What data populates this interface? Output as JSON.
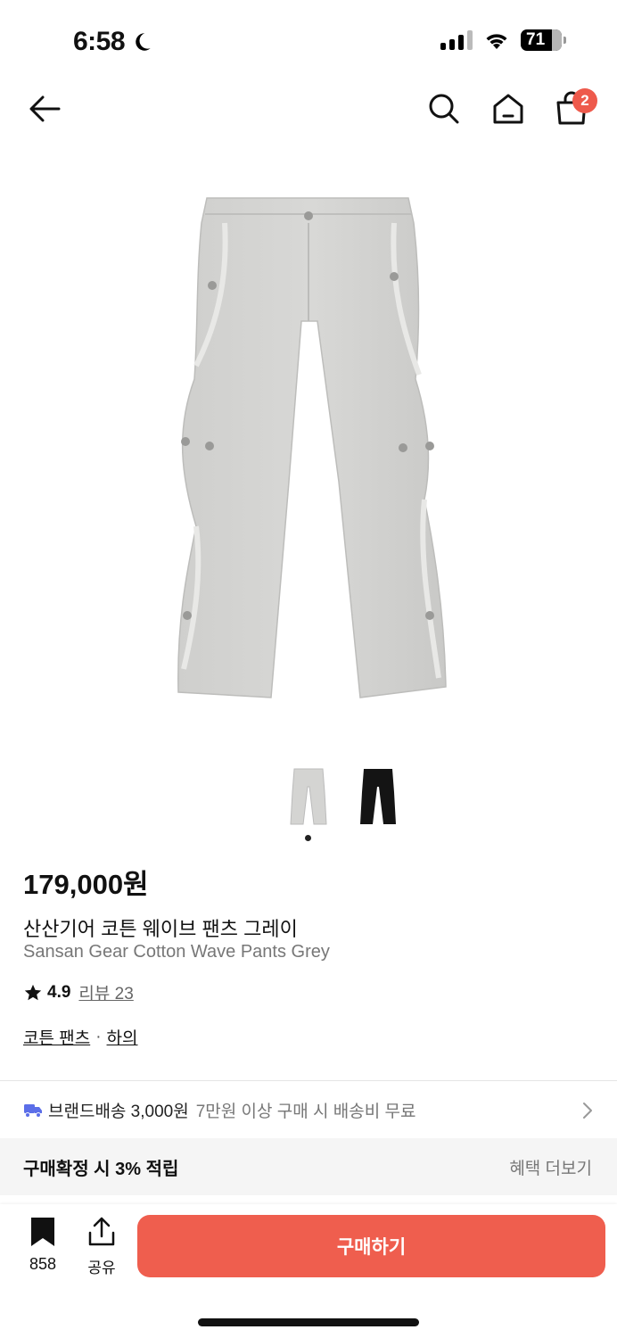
{
  "status_bar": {
    "time": "6:58",
    "battery": "71"
  },
  "header": {
    "cart_count": "2"
  },
  "product": {
    "price": "179,000원",
    "name_ko": "산산기어 코튼 웨이브 팬츠 그레이",
    "name_en": "Sansan Gear Cotton Wave Pants Grey",
    "rating": "4.9",
    "review_label": "리뷰 23",
    "category_primary": "코튼 팬츠",
    "category_separator": "·",
    "category_secondary": "하의",
    "colors": {
      "grey": "#d4d4d2",
      "black": "#141414"
    }
  },
  "shipping": {
    "label": "브랜드배송 3,000원",
    "note": "7만원 이상 구매 시 배송비 무료"
  },
  "benefit": {
    "title": "구매확정 시 3% 적립",
    "more_label": "혜택 더보기"
  },
  "bottom_bar": {
    "bookmark_count": "858",
    "share_label": "공유",
    "buy_label": "구매하기",
    "accent": "#ef5e4e"
  }
}
